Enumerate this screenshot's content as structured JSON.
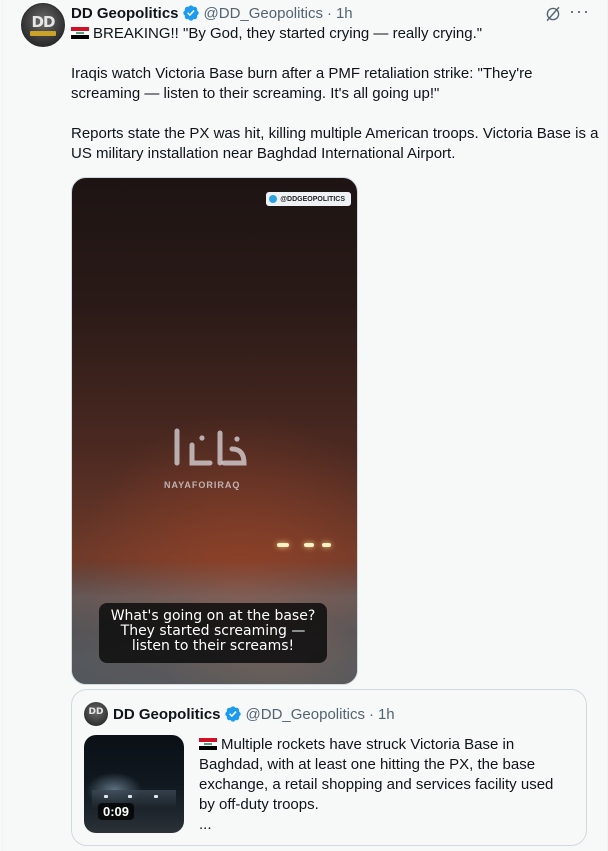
{
  "post": {
    "author_name": "DD Geopolitics",
    "avatar_text": "DD",
    "handle": "@DD_Geopolitics",
    "separator": "·",
    "time": "1h",
    "line1": "BREAKING!! \"By God, they started crying — really crying.\"",
    "line2": "Iraqis watch Victoria Base burn after a PMF retaliation strike: \"They're screaming — listen to their screaming. It's all going up!\"",
    "line3": "Reports state the PX was hit, killing multiple American troops. Victoria Base is a US military installation near Baghdad International Airport."
  },
  "media": {
    "watermark_handle": "@DDGEOPOLITICS",
    "naya_label": "NAYAFORIRAQ",
    "caption_line1": "What's going on at the base?",
    "caption_line2": "They started screaming —",
    "caption_line3": "listen to their screams!"
  },
  "quote": {
    "author_name": "DD Geopolitics",
    "avatar_text": "DD",
    "handle": "@DD_Geopolitics",
    "separator": "·",
    "time": "1h",
    "text": "Multiple rockets have struck Victoria Base in Baghdad, with at least one hitting the PX, the base exchange, a retail shopping and services facility used by off-duty troops.",
    "ellipsis": "...",
    "video_duration": "0:09"
  },
  "icons": {
    "verified": "verified-badge-icon",
    "grok": "grok-icon",
    "more": "more-icon",
    "flag": "iraq-flag-icon"
  },
  "colors": {
    "verified_blue": "#1d9bf0",
    "secondary_text": "#536471",
    "background": "#f7f9f9"
  }
}
